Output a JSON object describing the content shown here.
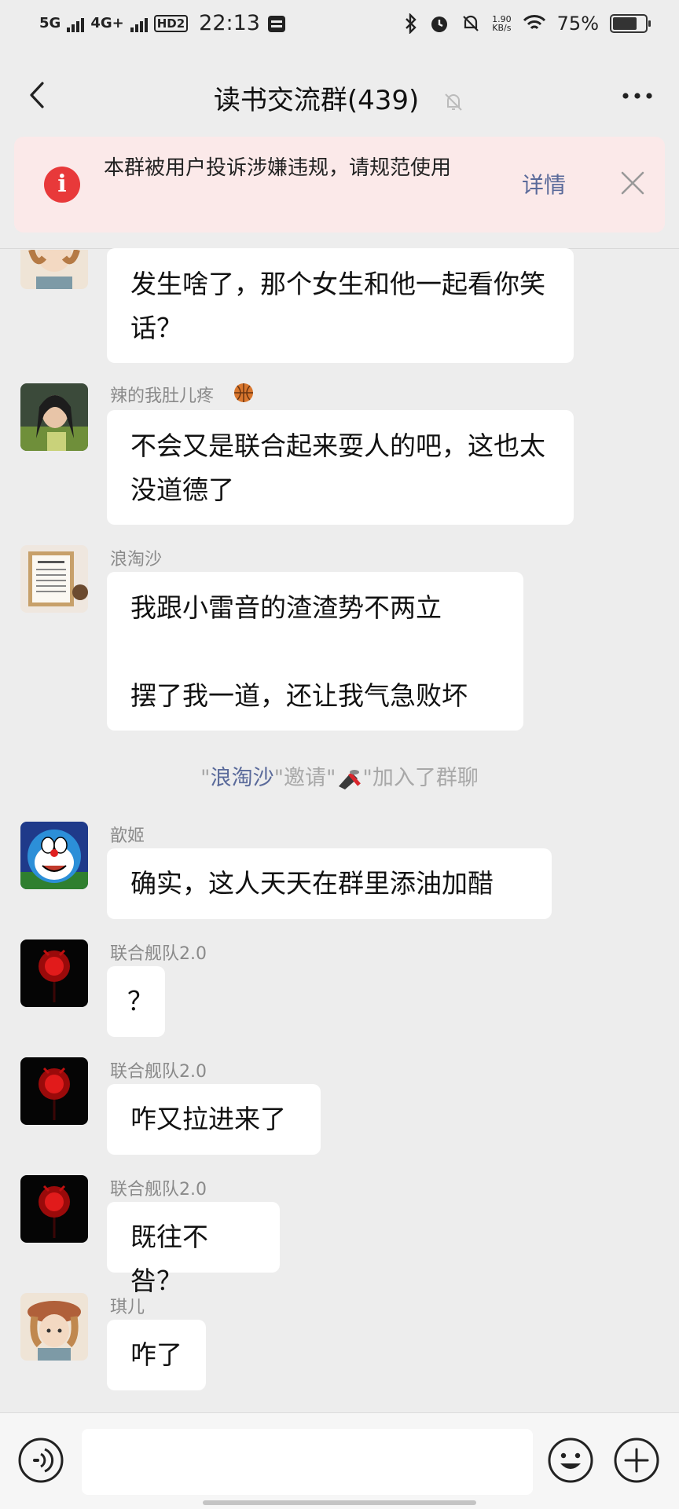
{
  "status_bar": {
    "network1": "5G",
    "network2": "4G+",
    "hd": "HD2",
    "time": "22:13",
    "speed_value": "1.90",
    "speed_unit": "KB/s",
    "battery": "75%",
    "battery_level": 0.75
  },
  "header": {
    "title": "读书交流群(439)",
    "back_icon": "chevron-left-icon",
    "mute_icon": "bell-off-icon",
    "more_icon": "more-dots-icon"
  },
  "notice": {
    "text": "本群被用户投诉涉嫌违规，请规范使用",
    "detail_label": "详情"
  },
  "messages": [
    {
      "sender": "",
      "text": "发生啥了，那个女生和他一起看你笑话？"
    },
    {
      "sender": "辣的我肚儿疼",
      "text": "不会又是联合起来耍人的吧，这也太没道德了"
    },
    {
      "sender": "浪淘沙",
      "text_line1": "我跟小雷音的渣渣势不两立",
      "text_line2": "摆了我一道，还让我气急败坏"
    },
    {
      "sender": "歆姬",
      "text": "确实，这人天天在群里添油加醋"
    },
    {
      "sender": "联合舰队2.0",
      "text": "？"
    },
    {
      "sender": "联合舰队2.0",
      "text": "咋又拉进来了"
    },
    {
      "sender": "联合舰队2.0",
      "text": "既往不咎？"
    },
    {
      "sender": "琪儿",
      "text": "咋了"
    }
  ],
  "system_message": {
    "q1": "\"",
    "inviter": "浪淘沙",
    "q2": "\"邀请\"",
    "q3": "\"加入了群聊"
  },
  "input": {
    "placeholder": ""
  },
  "colors": {
    "background": "#ededed",
    "notice_bg": "#fbe9e9",
    "notice_icon": "#e8393a",
    "link": "#5a6a9a"
  }
}
